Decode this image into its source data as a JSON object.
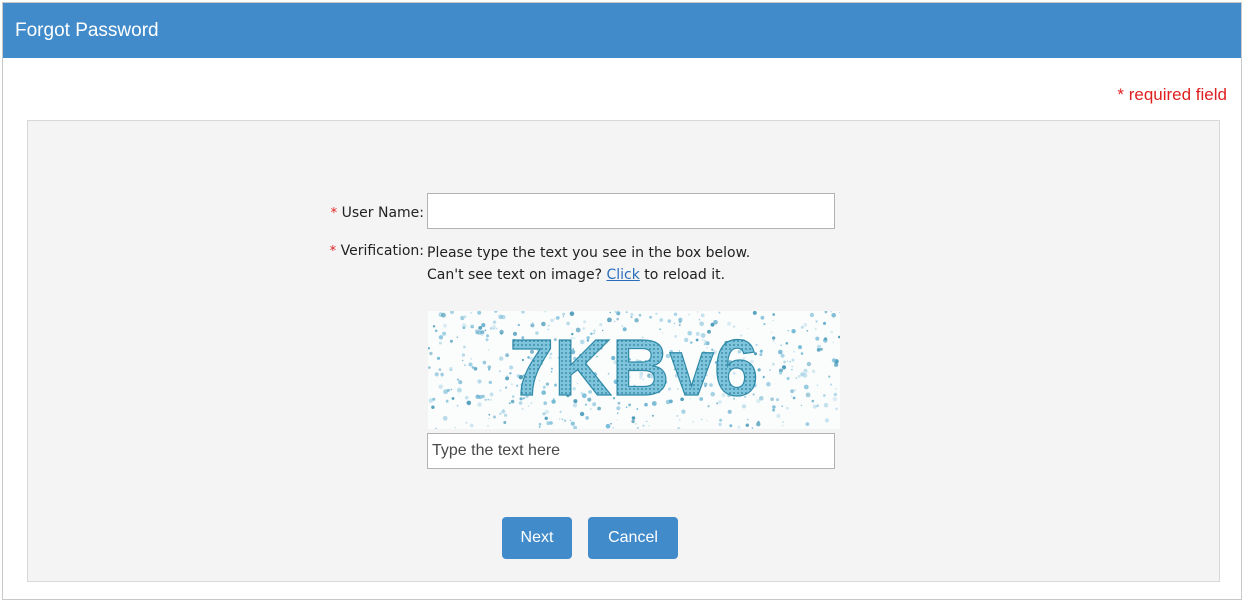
{
  "header": {
    "title": "Forgot Password"
  },
  "required_note": "* required field",
  "form": {
    "username": {
      "star": "*",
      "label": "User Name:",
      "value": ""
    },
    "verification": {
      "star": "*",
      "label": "Verification:",
      "line1": "Please type the text you see in the box below.",
      "line2_prefix": "Can't see text on image?",
      "link_text": "Click",
      "line2_suffix": "to reload it.",
      "captcha_text": "7KBv6",
      "input_placeholder": "Type the text here"
    }
  },
  "buttons": {
    "next": "Next",
    "cancel": "Cancel"
  },
  "colors": {
    "header": "#428bca",
    "button": "#428bca",
    "required": "#e02020",
    "link": "#2a6ebb"
  }
}
